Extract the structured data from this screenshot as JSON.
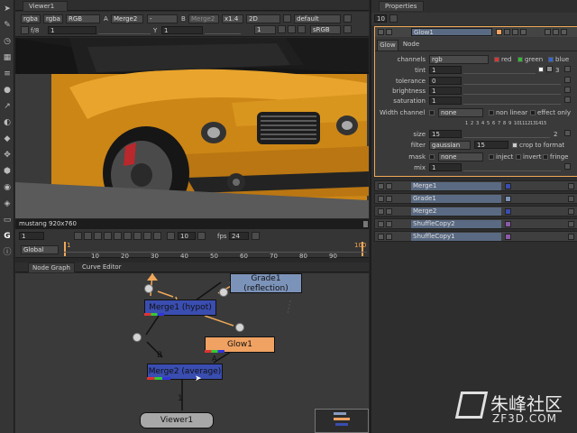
{
  "toolbar": {
    "icons": [
      "pointer-icon",
      "brush-icon",
      "clock-icon",
      "grid-icon",
      "layers-icon",
      "circle-icon",
      "curve-icon",
      "color-icon",
      "stack-icon",
      "move-icon",
      "blob-icon",
      "eye-icon",
      "tag-icon",
      "box-icon",
      "nuke-logo",
      "info-icon"
    ]
  },
  "viewer": {
    "tab": "Viewer1",
    "channels": "rgba",
    "layer": "rgba",
    "display": "RGB",
    "input_a": "Merge2",
    "dash": "-",
    "input_b": "Merge2",
    "zoom": "x1.4",
    "mode": "2D",
    "lut": "default",
    "fstop": "f/8",
    "gain": "1",
    "y_label": "Y",
    "gamma": "1",
    "proxy": "1",
    "colorspace": "sRGB",
    "caption": "mustang 920x760"
  },
  "timeline": {
    "frame": "1",
    "fps_label": "fps",
    "fps": "24",
    "step": "10",
    "scope": "Global",
    "ticks": [
      "1",
      "10",
      "20",
      "30",
      "40",
      "50",
      "60",
      "70",
      "80",
      "90",
      "100"
    ],
    "start_marker": "1",
    "end_marker": "100"
  },
  "graph": {
    "tabs": [
      "Node Graph",
      "Curve Editor"
    ],
    "nodes": {
      "grade": "Grade1\n(reflection)",
      "merge1": "Merge1 (hypot)",
      "glow": "Glow1",
      "merge2": "Merge2 (average)",
      "viewer": "Viewer1"
    },
    "pipe_labels": {
      "b": "B",
      "a": "A",
      "one": "1"
    }
  },
  "properties": {
    "tab": "Properties",
    "max_panels": "10",
    "node_name": "Glow1",
    "tabs": [
      "Glow",
      "Node"
    ],
    "channels_label": "channels",
    "channels": "rgb",
    "channel_toggles": [
      "red",
      "green",
      "blue"
    ],
    "tint_label": "tint",
    "tint": "1",
    "tint_extra": "3",
    "tolerance_label": "tolerance",
    "tolerance": "0",
    "brightness_label": "brightness",
    "brightness": "1",
    "saturation_label": "saturation",
    "saturation": "1",
    "width_channel_label": "Width channel",
    "width_channel": "none",
    "non_linear": "non linear",
    "effect_only": "effect only",
    "size_label": "size",
    "size": "15",
    "size_extra": "2",
    "filter_label": "filter",
    "filter": "gaussian",
    "filter_value": "15",
    "crop": "crop to format",
    "mask_label": "mask",
    "mask": "none",
    "inject": "inject",
    "invert": "invert",
    "fringe": "fringe",
    "mix_label": "mix",
    "mix": "1",
    "slider_ticks": [
      "1",
      "2",
      "3",
      "4",
      "5",
      "6",
      "7",
      "8",
      "9",
      "10",
      "11",
      "12",
      "13",
      "14",
      "15"
    ],
    "collapsed_panels": [
      "Merge1",
      "Grade1",
      "Merge2",
      "ShuffleCopy2",
      "ShuffleCopy1"
    ]
  },
  "watermark": {
    "brand": "朱峰社区",
    "url": "ZF3D.COM"
  },
  "colors": {
    "accent": "#f0a858",
    "merge": "#3a4db0",
    "grade": "#7c93b9",
    "glow": "#f0a262"
  }
}
